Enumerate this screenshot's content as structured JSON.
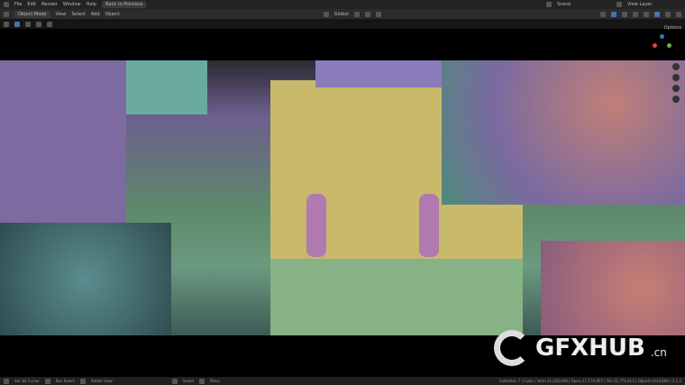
{
  "menu": {
    "items": [
      "File",
      "Edit",
      "Render",
      "Window",
      "Help"
    ],
    "back_button": "Back to Previous",
    "scene": "Scene",
    "view_layer": "View Layer"
  },
  "header": {
    "mode": "Object Mode",
    "menus": [
      "View",
      "Select",
      "Add",
      "Object"
    ],
    "transform": "Global",
    "options": "Options"
  },
  "status": {
    "left": [
      "Set 3D Cursor",
      "Box Select",
      "Rotate View",
      "Select",
      "Move"
    ],
    "right": "Collection 7 | Cube | Verts 21,230,608 | Faces 17,174,857 | Tris 21,774,413 | Objects 0/14,860 | 3.1.2"
  },
  "watermark": {
    "text": "GFXHUB",
    "suffix": ".cn"
  },
  "colors": {
    "accent": "#4772b3",
    "viewport_bg": "#000000"
  }
}
